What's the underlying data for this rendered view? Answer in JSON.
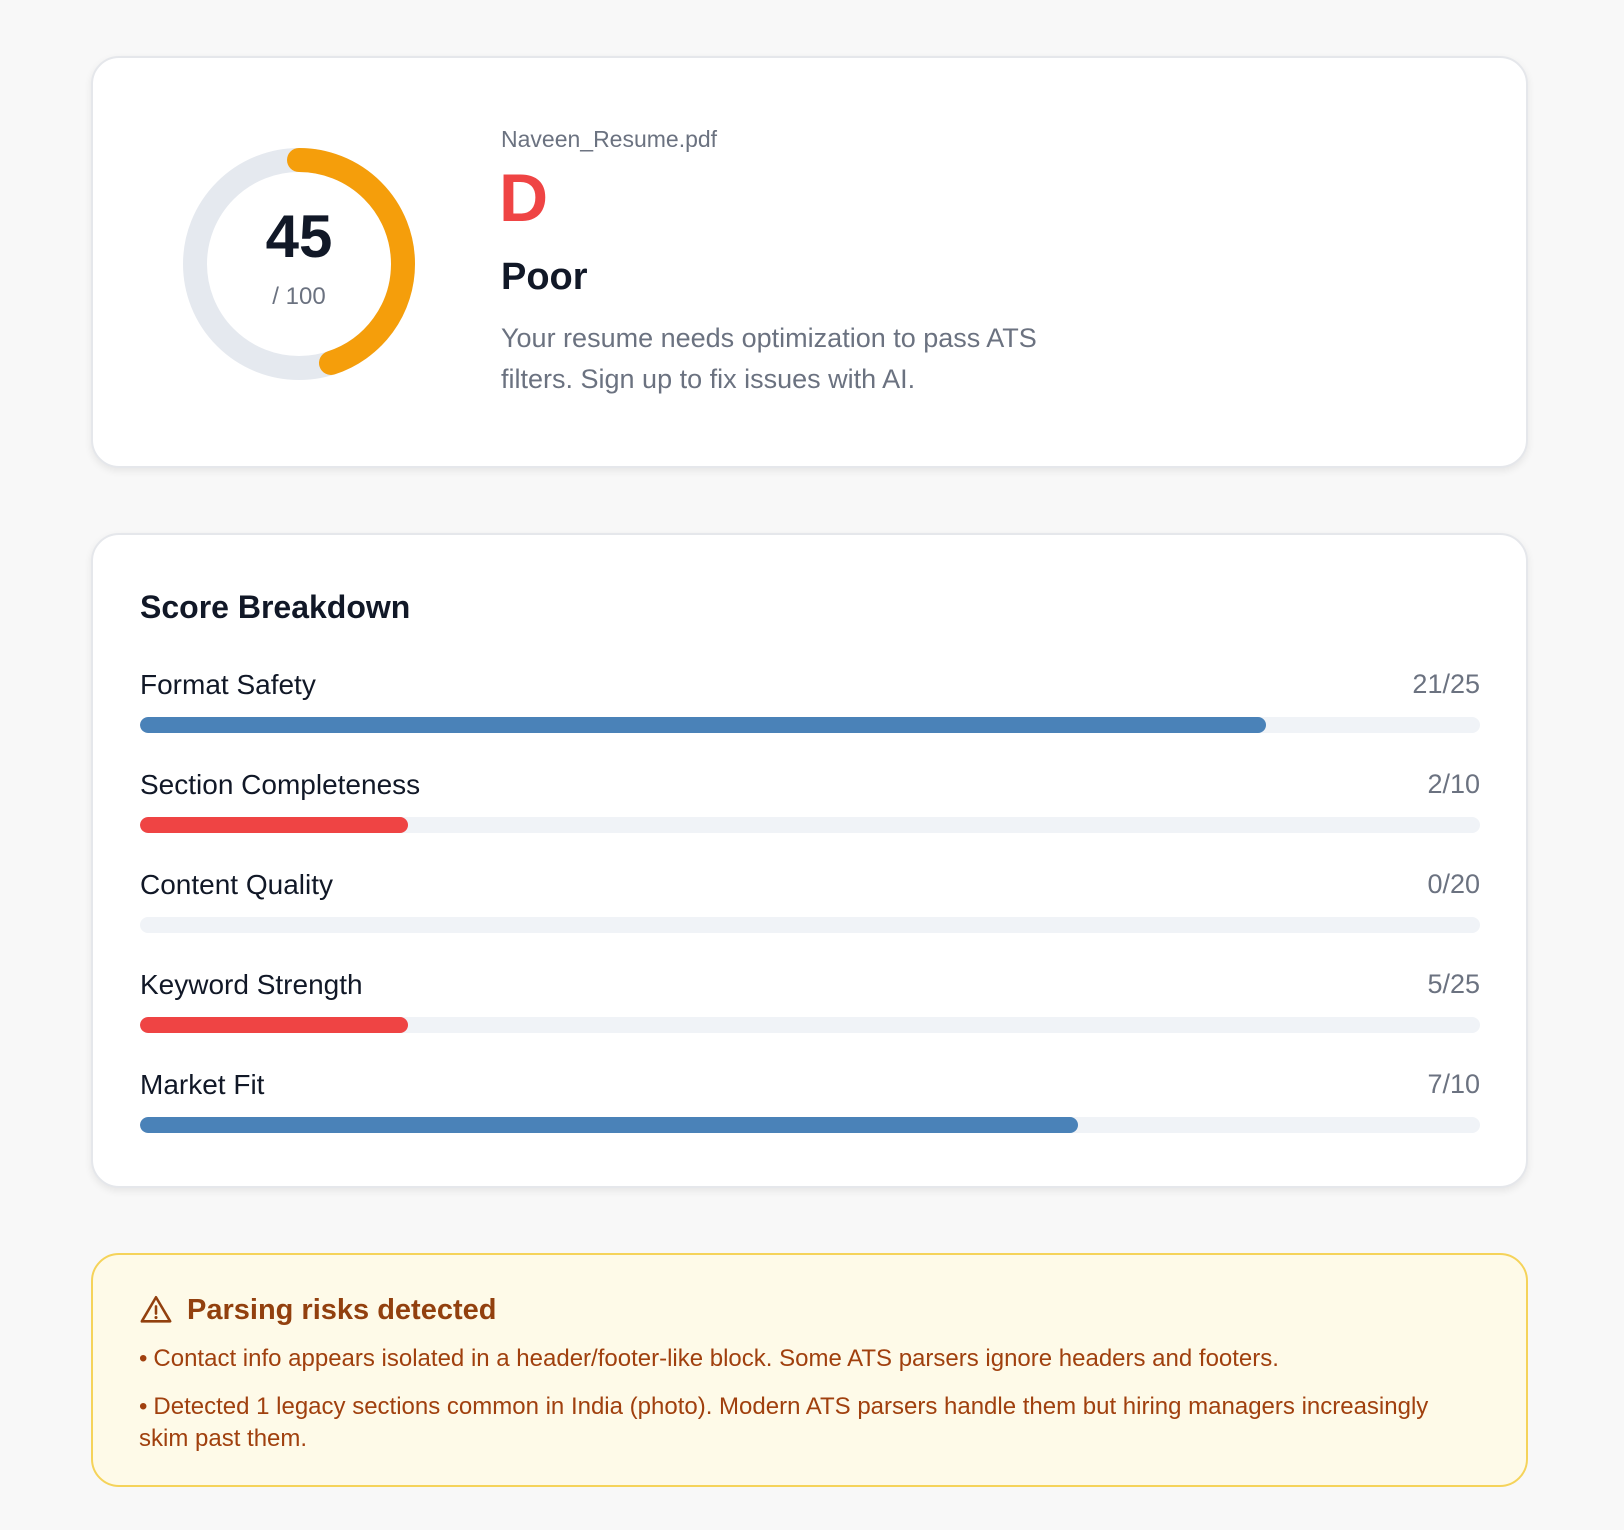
{
  "score_card": {
    "score": 45,
    "score_max_label": "/ 100",
    "ring_color": "#f59e0b",
    "ring_track_color": "#e5e9ef",
    "file_name": "Naveen_Resume.pdf",
    "grade": "D",
    "rating": "Poor",
    "summary": "Your resume needs optimization to pass ATS filters. Sign up to fix issues with AI."
  },
  "breakdown": {
    "title": "Score Breakdown",
    "items": [
      {
        "label": "Format Safety",
        "value": "21/25",
        "score": 21,
        "max": 25,
        "color": "#4a82b8"
      },
      {
        "label": "Section Completeness",
        "value": "2/10",
        "score": 2,
        "max": 10,
        "color": "#ef4444"
      },
      {
        "label": "Content Quality",
        "value": "0/20",
        "score": 0,
        "max": 20,
        "color": "#ef4444"
      },
      {
        "label": "Keyword Strength",
        "value": "5/25",
        "score": 5,
        "max": 25,
        "color": "#ef4444"
      },
      {
        "label": "Market Fit",
        "value": "7/10",
        "score": 7,
        "max": 10,
        "color": "#4a82b8"
      }
    ]
  },
  "warnings": {
    "icon": "warning-triangle-icon",
    "title": "Parsing risks detected",
    "bullet": "•",
    "items": [
      "Contact info appears isolated in a header/footer-like block. Some ATS parsers ignore headers and footers.",
      "Detected 1 legacy sections common in India (photo). Modern ATS parsers handle them but hiring managers increasingly skim past them."
    ]
  }
}
